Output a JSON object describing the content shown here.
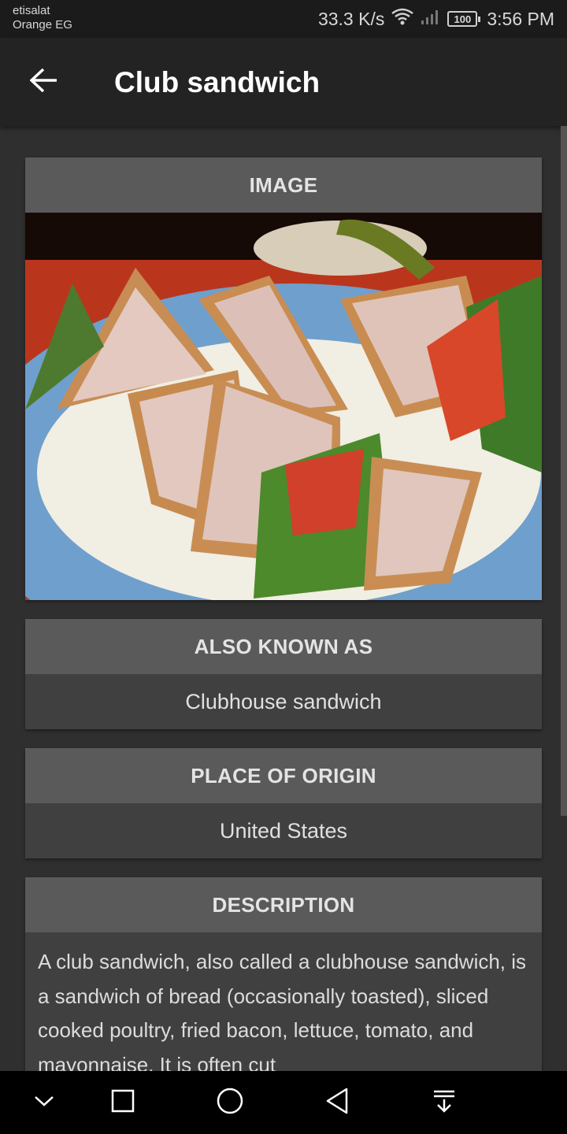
{
  "status_bar": {
    "carrier_line1": "etisalat",
    "carrier_line2": "Orange EG",
    "speed": "33.3 K/s",
    "battery": "100",
    "time": "3:56 PM"
  },
  "app_bar": {
    "title": "Club sandwich",
    "back_icon": "arrow-back-icon"
  },
  "sections": {
    "image": {
      "header": "IMAGE"
    },
    "aka": {
      "header": "ALSO KNOWN AS",
      "value": "Clubhouse sandwich"
    },
    "origin": {
      "header": "PLACE OF ORIGIN",
      "value": "United States"
    },
    "description": {
      "header": "DESCRIPTION",
      "text": "A club sandwich, also called a clubhouse sandwich, is a sandwich of bread (occasionally toasted), sliced cooked poultry, fried bacon, lettuce, tomato, and mayonnaise. It is often cut"
    }
  },
  "nav_bar": {
    "icons": [
      "chevron-down-icon",
      "recents-square-icon",
      "home-circle-icon",
      "back-triangle-icon",
      "notification-pull-icon"
    ]
  },
  "colors": {
    "background": "#2f2f2f",
    "app_bar": "#232323",
    "card": "#404040",
    "card_header": "#5a5a5a"
  }
}
